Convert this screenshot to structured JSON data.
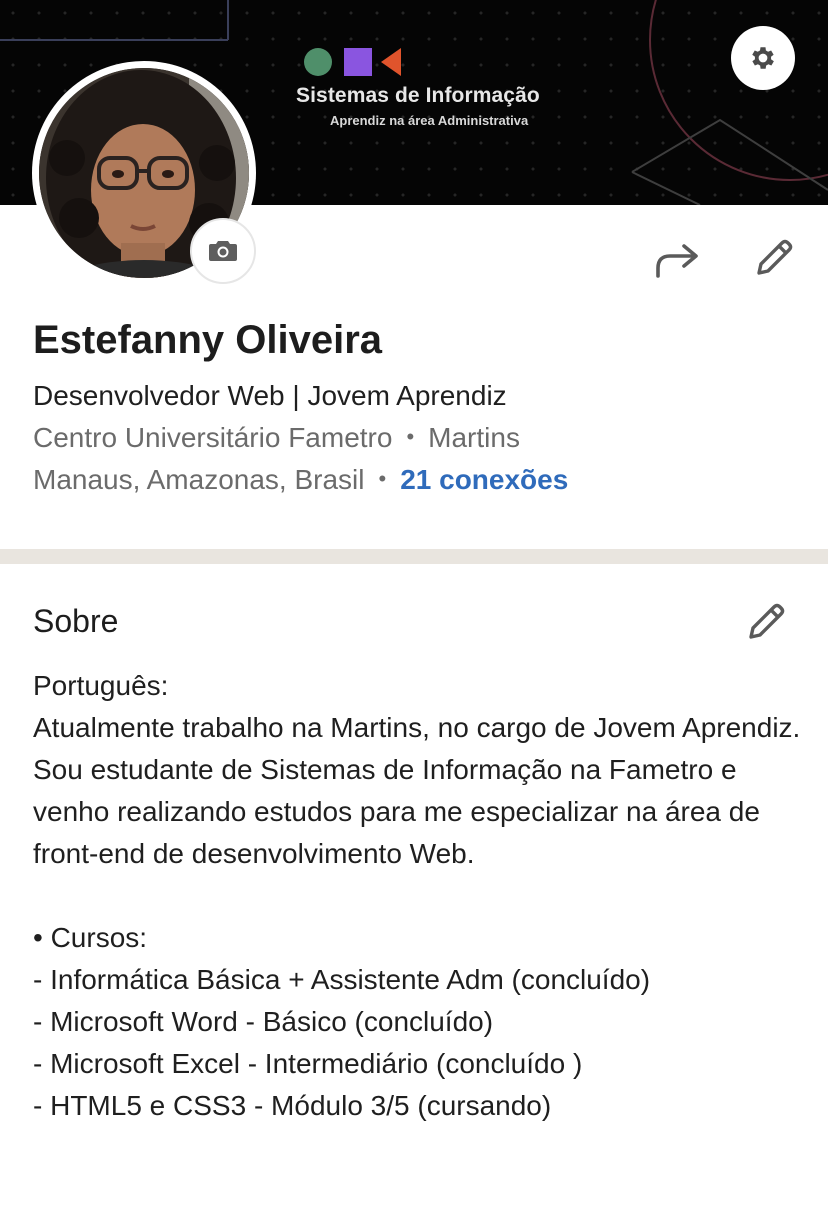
{
  "banner": {
    "title": "Sistemas de Informação",
    "subtitle": "Aprendiz na área Administrativa",
    "colors": {
      "background": "#050505",
      "circle": "#4f8f6a",
      "square": "#8a55e0",
      "triangle": "#e0542c"
    }
  },
  "icons": {
    "settings": "gear-icon",
    "camera": "camera-icon",
    "share": "share-arrow-icon",
    "edit": "pencil-icon"
  },
  "profile": {
    "name": "Estefanny Oliveira",
    "headline": "Desenvolvedor Web | Jovem Aprendiz",
    "education": "Centro Universitário Fametro",
    "company": "Martins",
    "location": "Manaus, Amazonas, Brasil",
    "connections": "21 conexões",
    "separator": "•"
  },
  "about": {
    "title": "Sobre",
    "lines": [
      "Português:",
      "Atualmente trabalho na Martins, no cargo de Jovem Aprendiz. Sou estudante de Sistemas de Informação na Fametro e venho realizando estudos para me especializar na área de front-end de desenvolvimento Web.",
      "",
      "• Cursos:",
      "- Informática Básica + Assistente Adm (concluído)",
      "- Microsoft Word - Básico (concluído)",
      "- Microsoft Excel - Intermediário (concluído )",
      "- HTML5 e CSS3 - Módulo 3/5 (cursando)"
    ]
  },
  "colors": {
    "link": "#2f6bbb",
    "secondary_text": "#6b6b6b",
    "divider": "#e9e5df"
  }
}
